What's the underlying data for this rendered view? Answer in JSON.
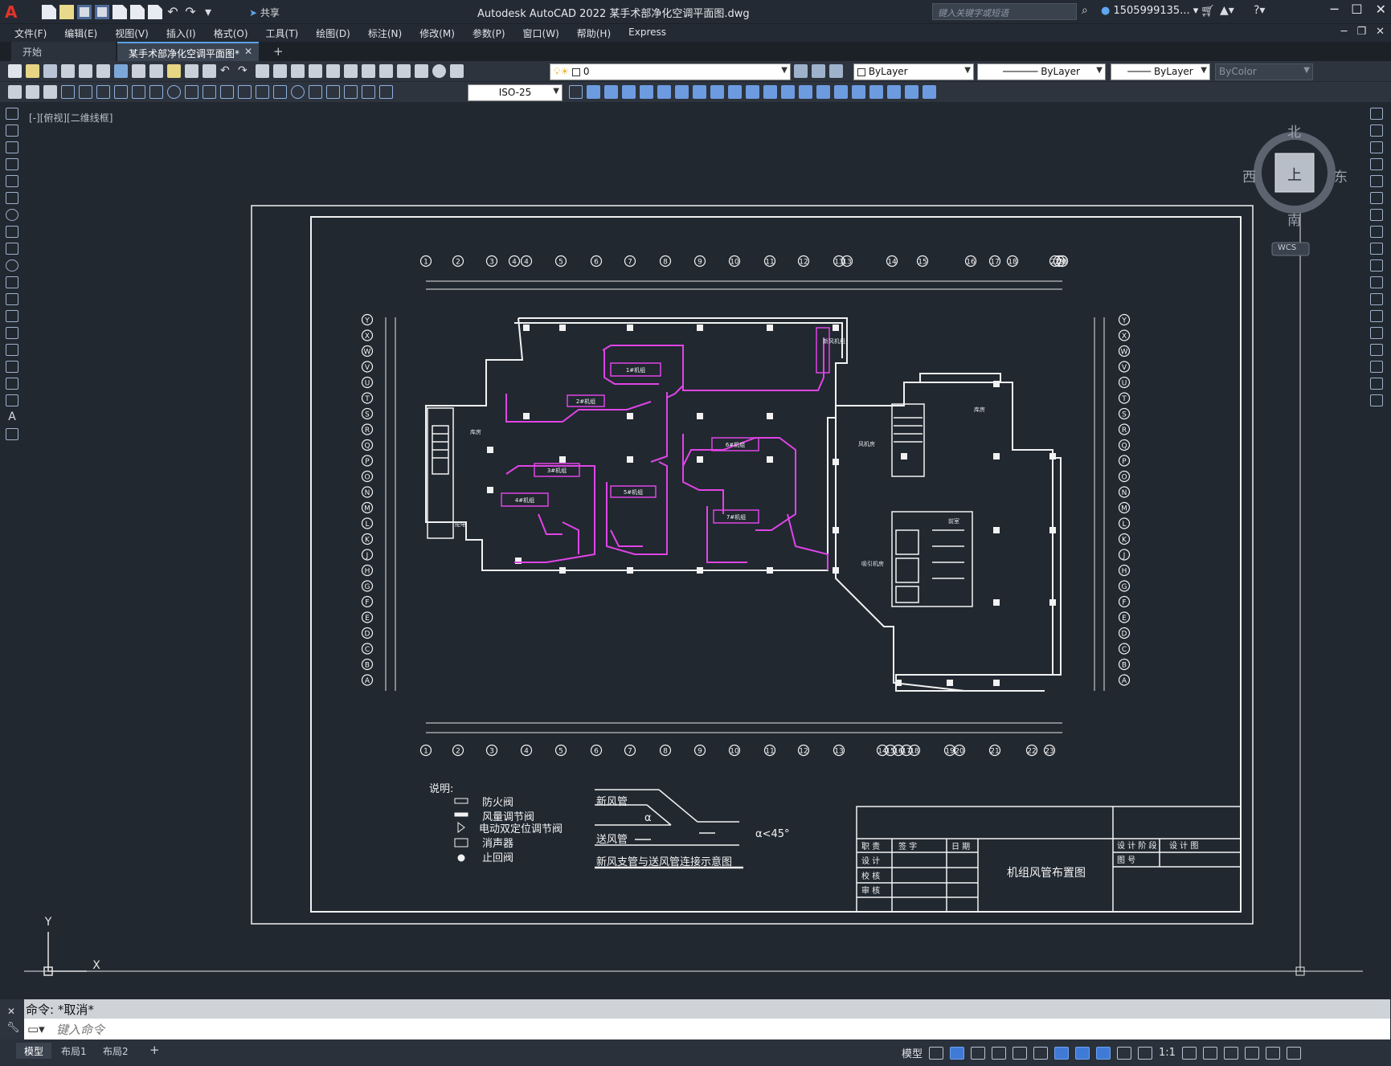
{
  "app": {
    "title": "Autodesk AutoCAD 2022    某手术部净化空调平面图.dwg",
    "share_label": "共享",
    "search_placeholder": "键入关键字或短语",
    "user": "1505999135...",
    "logo": "A"
  },
  "menu": {
    "items": [
      "文件(F)",
      "编辑(E)",
      "视图(V)",
      "插入(I)",
      "格式(O)",
      "工具(T)",
      "绘图(D)",
      "标注(N)",
      "修改(M)",
      "参数(P)",
      "窗口(W)",
      "帮助(H)",
      "Express"
    ]
  },
  "tabs": {
    "start": "开始",
    "drawing": "某手术部净化空调平面图*",
    "add": "+"
  },
  "toolbar": {
    "layer_value": "0",
    "color": "ByLayer",
    "linetype": "ByLayer",
    "lineweight": "ByLayer",
    "plotstyle": "ByColor",
    "dimstyle": "ISO-25"
  },
  "viewport": {
    "label": "[-][俯视][二维线框]",
    "wcs": "WCS",
    "cube_top": "上",
    "north": "北",
    "south": "南",
    "east": "东",
    "west": "西",
    "axis_x": "X",
    "axis_y": "Y"
  },
  "drawing": {
    "legend_title": "说明:",
    "legend": [
      "防火阀",
      "风量调节阀",
      "电动双定位调节阀",
      "消声器",
      "止回阀"
    ],
    "xinfeng": "新风管",
    "songfeng": "送风管",
    "alpha": "α",
    "angle_note": "α<45°",
    "diagram_caption": "新风支管与送风管连接示意图",
    "title_block": {
      "drawing_name": "机组风管布置图",
      "rows": [
        "职 责",
        "设 计",
        "校 核",
        "审 核"
      ],
      "signature": "签    字",
      "date": "日 期",
      "stage": "设 计 阶 段",
      "stage_value": "设 计 图",
      "drawing_no": "图    号"
    },
    "axis_top": [
      "1",
      "2",
      "3",
      "4",
      "4",
      "5",
      "6",
      "7",
      "8",
      "9",
      "10",
      "11",
      "12",
      "13",
      "13",
      "14",
      "15",
      "16",
      "17",
      "18",
      "19",
      "20",
      "22",
      "23"
    ],
    "axis_bottom": [
      "1",
      "2",
      "3",
      "4",
      "5",
      "6",
      "7",
      "8",
      "9",
      "10",
      "11",
      "12",
      "13",
      "14",
      "15",
      "16",
      "17",
      "18",
      "19",
      "20",
      "21",
      "22",
      "23"
    ],
    "axis_left": [
      "Y",
      "X",
      "W",
      "V",
      "U",
      "T",
      "S",
      "R",
      "Q",
      "P",
      "O",
      "N",
      "M",
      "L",
      "K",
      "J",
      "H",
      "G",
      "F",
      "E",
      "D",
      "C",
      "B",
      "A"
    ],
    "rooms": [
      "库房",
      "配电",
      "风机房",
      "库房",
      "前室",
      "吸引机房",
      "新风机组"
    ],
    "units": [
      "1#机组",
      "2#机组",
      "3#机组",
      "4#机组",
      "5#机组",
      "6#机组",
      "7#机组"
    ]
  },
  "command": {
    "history": "命令: *取消*",
    "placeholder": "键入命令"
  },
  "status": {
    "model": "模型",
    "layout1": "布局1",
    "layout2": "布局2",
    "add": "+",
    "model_btn": "模型",
    "scale": "1:1"
  }
}
